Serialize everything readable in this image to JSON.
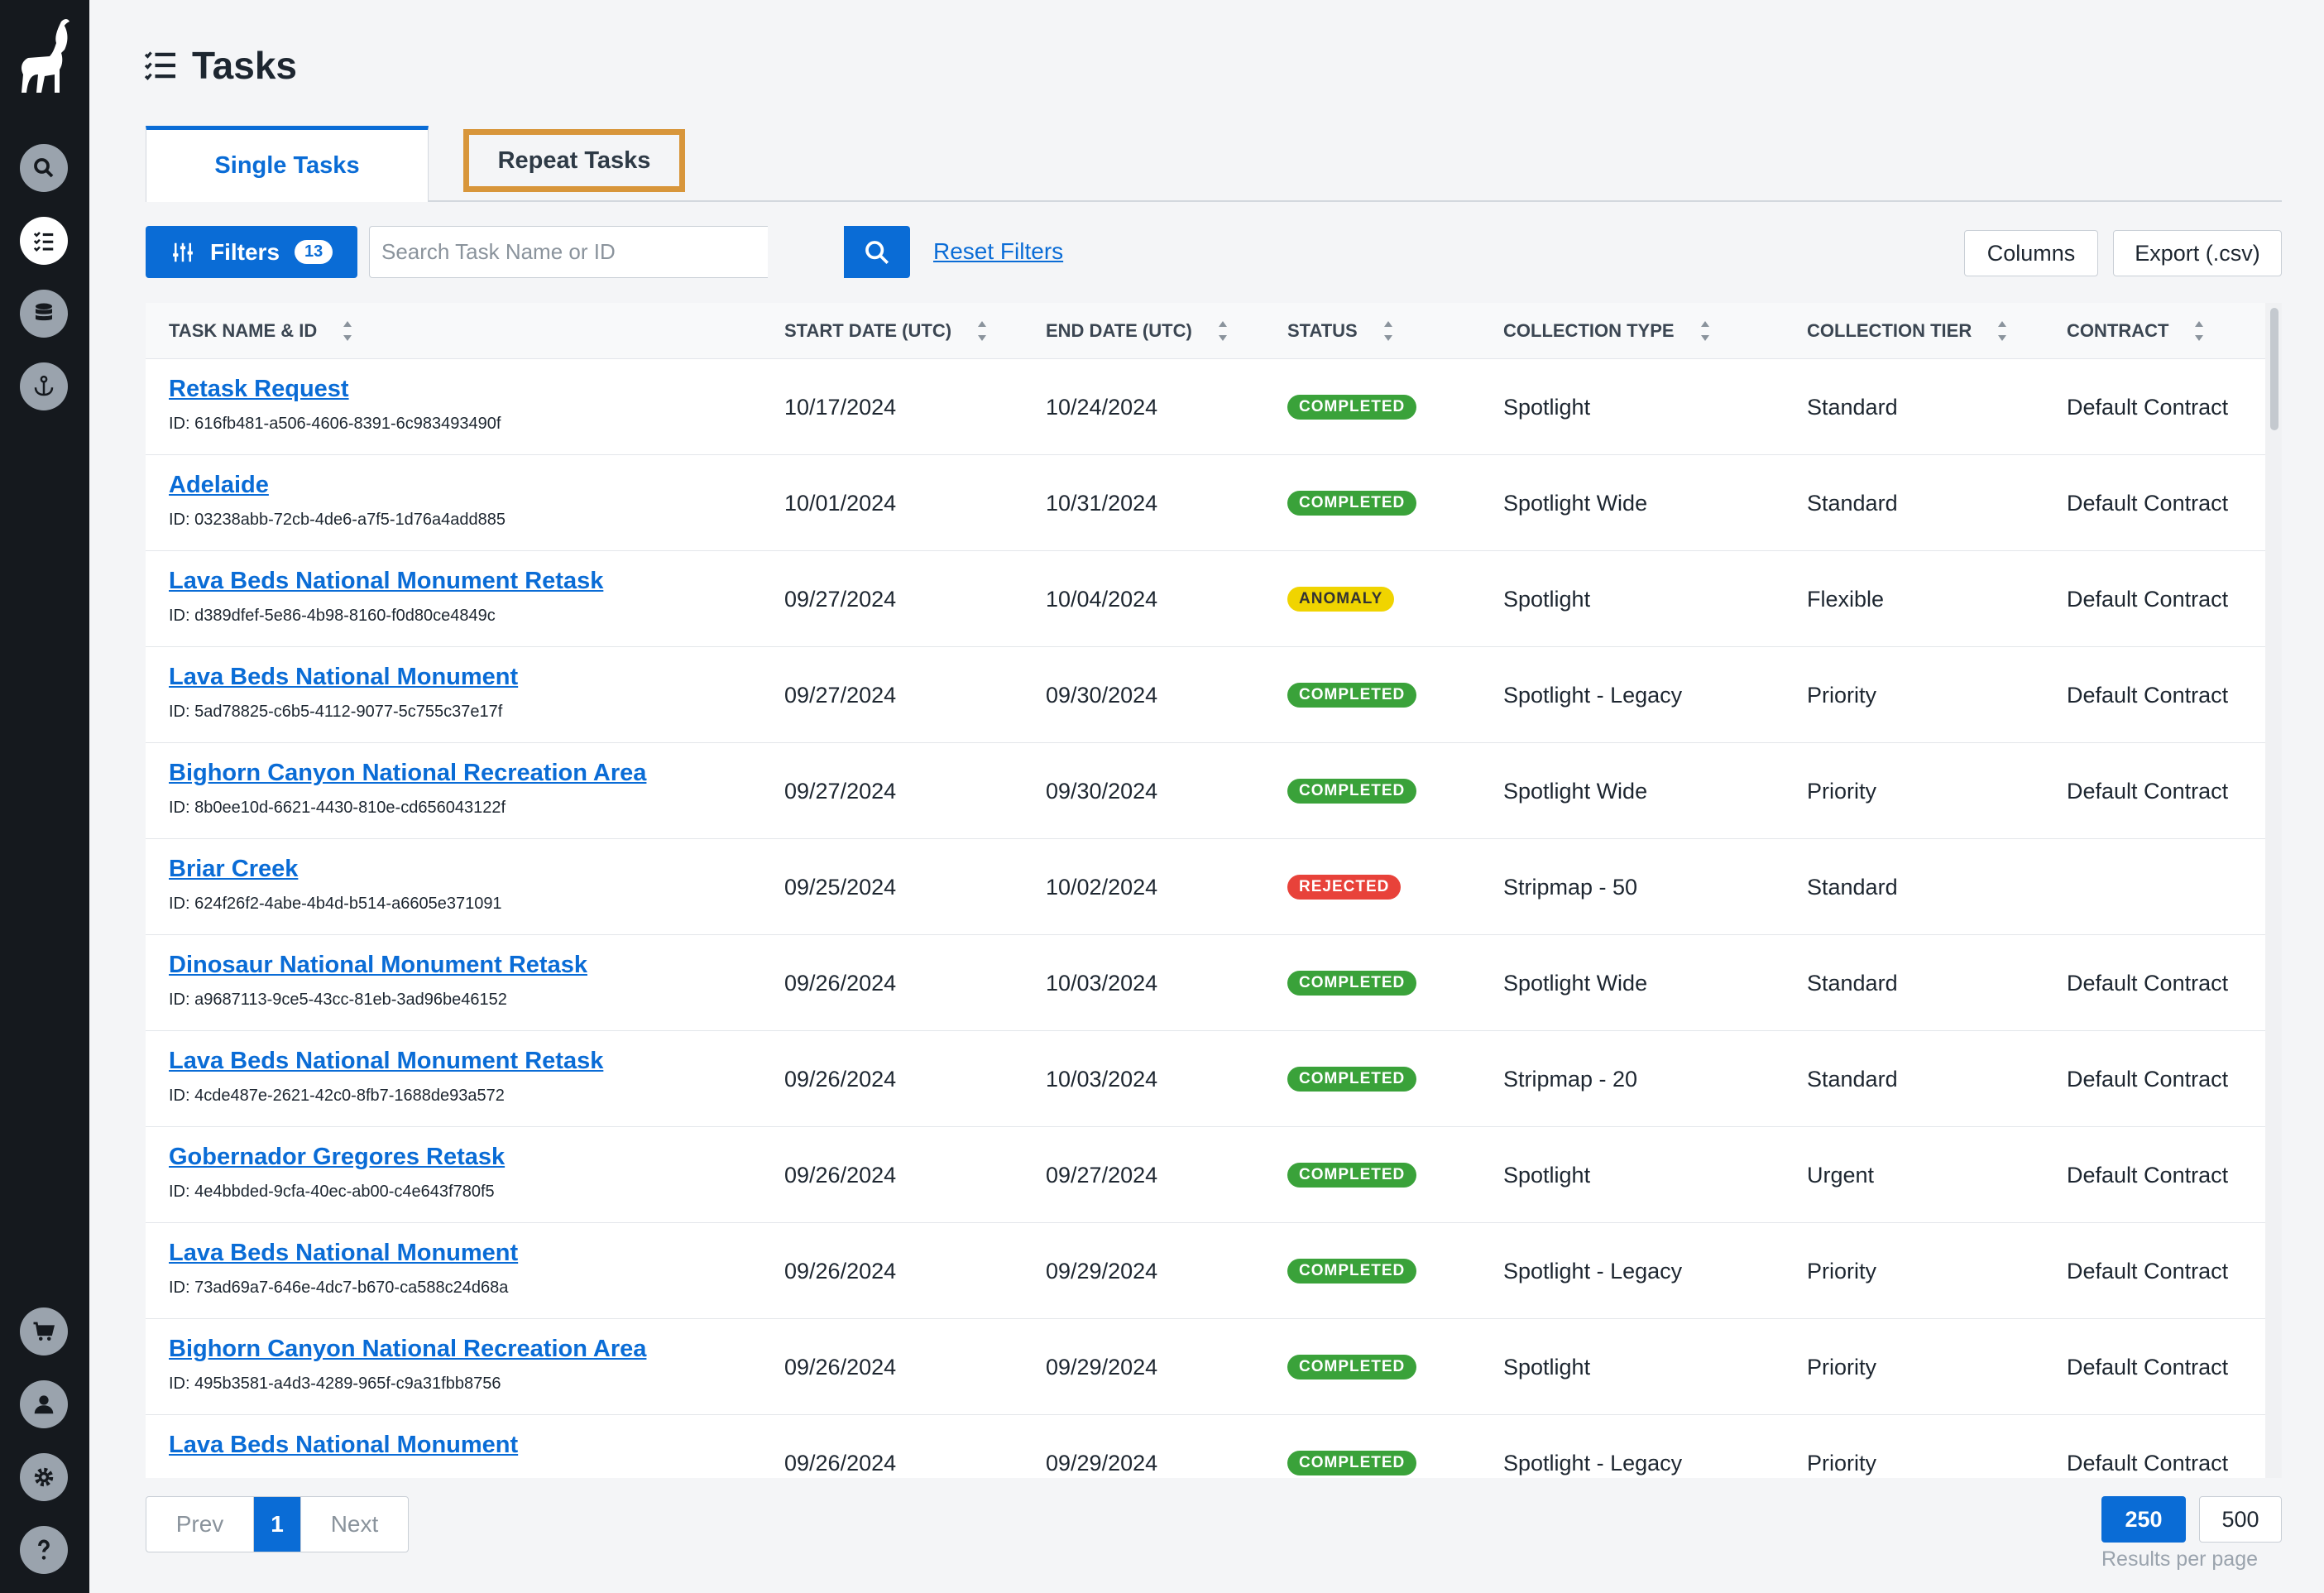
{
  "sidebar": {
    "logo": "ibex-logo",
    "items": [
      {
        "icon": "search-icon"
      },
      {
        "icon": "tasks-list-icon",
        "active": true
      },
      {
        "icon": "database-icon"
      },
      {
        "icon": "anchor-icon"
      },
      {
        "icon": "cart-icon"
      },
      {
        "icon": "user-icon"
      },
      {
        "icon": "gear-icon"
      },
      {
        "icon": "help-icon"
      }
    ]
  },
  "header": {
    "title": "Tasks"
  },
  "tabs": [
    {
      "label": "Single Tasks",
      "active": true
    },
    {
      "label": "Repeat Tasks",
      "highlighted": true
    }
  ],
  "toolbar": {
    "filters_label": "Filters",
    "filters_count": "13",
    "search_placeholder": "Search Task Name or ID",
    "reset_label": "Reset Filters",
    "columns_label": "Columns",
    "export_label": "Export (.csv)"
  },
  "table": {
    "columns": [
      "TASK NAME & ID",
      "START DATE (UTC)",
      "END DATE (UTC)",
      "STATUS",
      "COLLECTION TYPE",
      "COLLECTION TIER",
      "CONTRACT"
    ],
    "rows": [
      {
        "name": "Retask Request",
        "id": "ID: 616fb481-a506-4606-8391-6c983493490f",
        "start": "10/17/2024",
        "end": "10/24/2024",
        "status": "COMPLETED",
        "status_kind": "completed",
        "type": "Spotlight",
        "tier": "Standard",
        "contract": "Default Contract"
      },
      {
        "name": "Adelaide",
        "id": "ID: 03238abb-72cb-4de6-a7f5-1d76a4add885",
        "start": "10/01/2024",
        "end": "10/31/2024",
        "status": "COMPLETED",
        "status_kind": "completed",
        "type": "Spotlight Wide",
        "tier": "Standard",
        "contract": "Default Contract"
      },
      {
        "name": "Lava Beds National Monument Retask",
        "id": "ID: d389dfef-5e86-4b98-8160-f0d80ce4849c",
        "start": "09/27/2024",
        "end": "10/04/2024",
        "status": "ANOMALY",
        "status_kind": "anomaly",
        "type": "Spotlight",
        "tier": "Flexible",
        "contract": "Default Contract"
      },
      {
        "name": "Lava Beds National Monument",
        "id": "ID: 5ad78825-c6b5-4112-9077-5c755c37e17f",
        "start": "09/27/2024",
        "end": "09/30/2024",
        "status": "COMPLETED",
        "status_kind": "completed",
        "type": "Spotlight - Legacy",
        "tier": "Priority",
        "contract": "Default Contract"
      },
      {
        "name": "Bighorn Canyon National Recreation Area",
        "id": "ID: 8b0ee10d-6621-4430-810e-cd656043122f",
        "start": "09/27/2024",
        "end": "09/30/2024",
        "status": "COMPLETED",
        "status_kind": "completed",
        "type": "Spotlight Wide",
        "tier": "Priority",
        "contract": "Default Contract"
      },
      {
        "name": "Briar Creek",
        "id": "ID: 624f26f2-4abe-4b4d-b514-a6605e371091",
        "start": "09/25/2024",
        "end": "10/02/2024",
        "status": "REJECTED",
        "status_kind": "rejected",
        "type": "Stripmap - 50",
        "tier": "Standard",
        "contract": ""
      },
      {
        "name": "Dinosaur National Monument Retask",
        "id": "ID: a9687113-9ce5-43cc-81eb-3ad96be46152",
        "start": "09/26/2024",
        "end": "10/03/2024",
        "status": "COMPLETED",
        "status_kind": "completed",
        "type": "Spotlight Wide",
        "tier": "Standard",
        "contract": "Default Contract"
      },
      {
        "name": "Lava Beds National Monument Retask",
        "id": "ID: 4cde487e-2621-42c0-8fb7-1688de93a572",
        "start": "09/26/2024",
        "end": "10/03/2024",
        "status": "COMPLETED",
        "status_kind": "completed",
        "type": "Stripmap - 20",
        "tier": "Standard",
        "contract": "Default Contract"
      },
      {
        "name": "Gobernador Gregores Retask",
        "id": "ID: 4e4bbded-9cfa-40ec-ab00-c4e643f780f5",
        "start": "09/26/2024",
        "end": "09/27/2024",
        "status": "COMPLETED",
        "status_kind": "completed",
        "type": "Spotlight",
        "tier": "Urgent",
        "contract": "Default Contract"
      },
      {
        "name": "Lava Beds National Monument",
        "id": "ID: 73ad69a7-646e-4dc7-b670-ca588c24d68a",
        "start": "09/26/2024",
        "end": "09/29/2024",
        "status": "COMPLETED",
        "status_kind": "completed",
        "type": "Spotlight - Legacy",
        "tier": "Priority",
        "contract": "Default Contract"
      },
      {
        "name": "Bighorn Canyon National Recreation Area",
        "id": "ID: 495b3581-a4d3-4289-965f-c9a31fbb8756",
        "start": "09/26/2024",
        "end": "09/29/2024",
        "status": "COMPLETED",
        "status_kind": "completed",
        "type": "Spotlight",
        "tier": "Priority",
        "contract": "Default Contract"
      },
      {
        "name": "Lava Beds National Monument",
        "id": "",
        "start": "09/26/2024",
        "end": "09/29/2024",
        "status": "COMPLETED",
        "status_kind": "completed",
        "type": "Spotlight - Legacy",
        "tier": "Priority",
        "contract": "Default Contract"
      }
    ]
  },
  "pagination": {
    "prev": "Prev",
    "current": "1",
    "next": "Next"
  },
  "results_per_page": {
    "options": [
      "250",
      "500"
    ],
    "selected": "250",
    "label": "Results per page"
  },
  "colors": {
    "accent": "#0a6cd6",
    "sidebar": "#15191e",
    "highlight": "#d8963b",
    "completed": "#3aa23a",
    "anomaly": "#f0d400",
    "rejected": "#e8423a"
  }
}
